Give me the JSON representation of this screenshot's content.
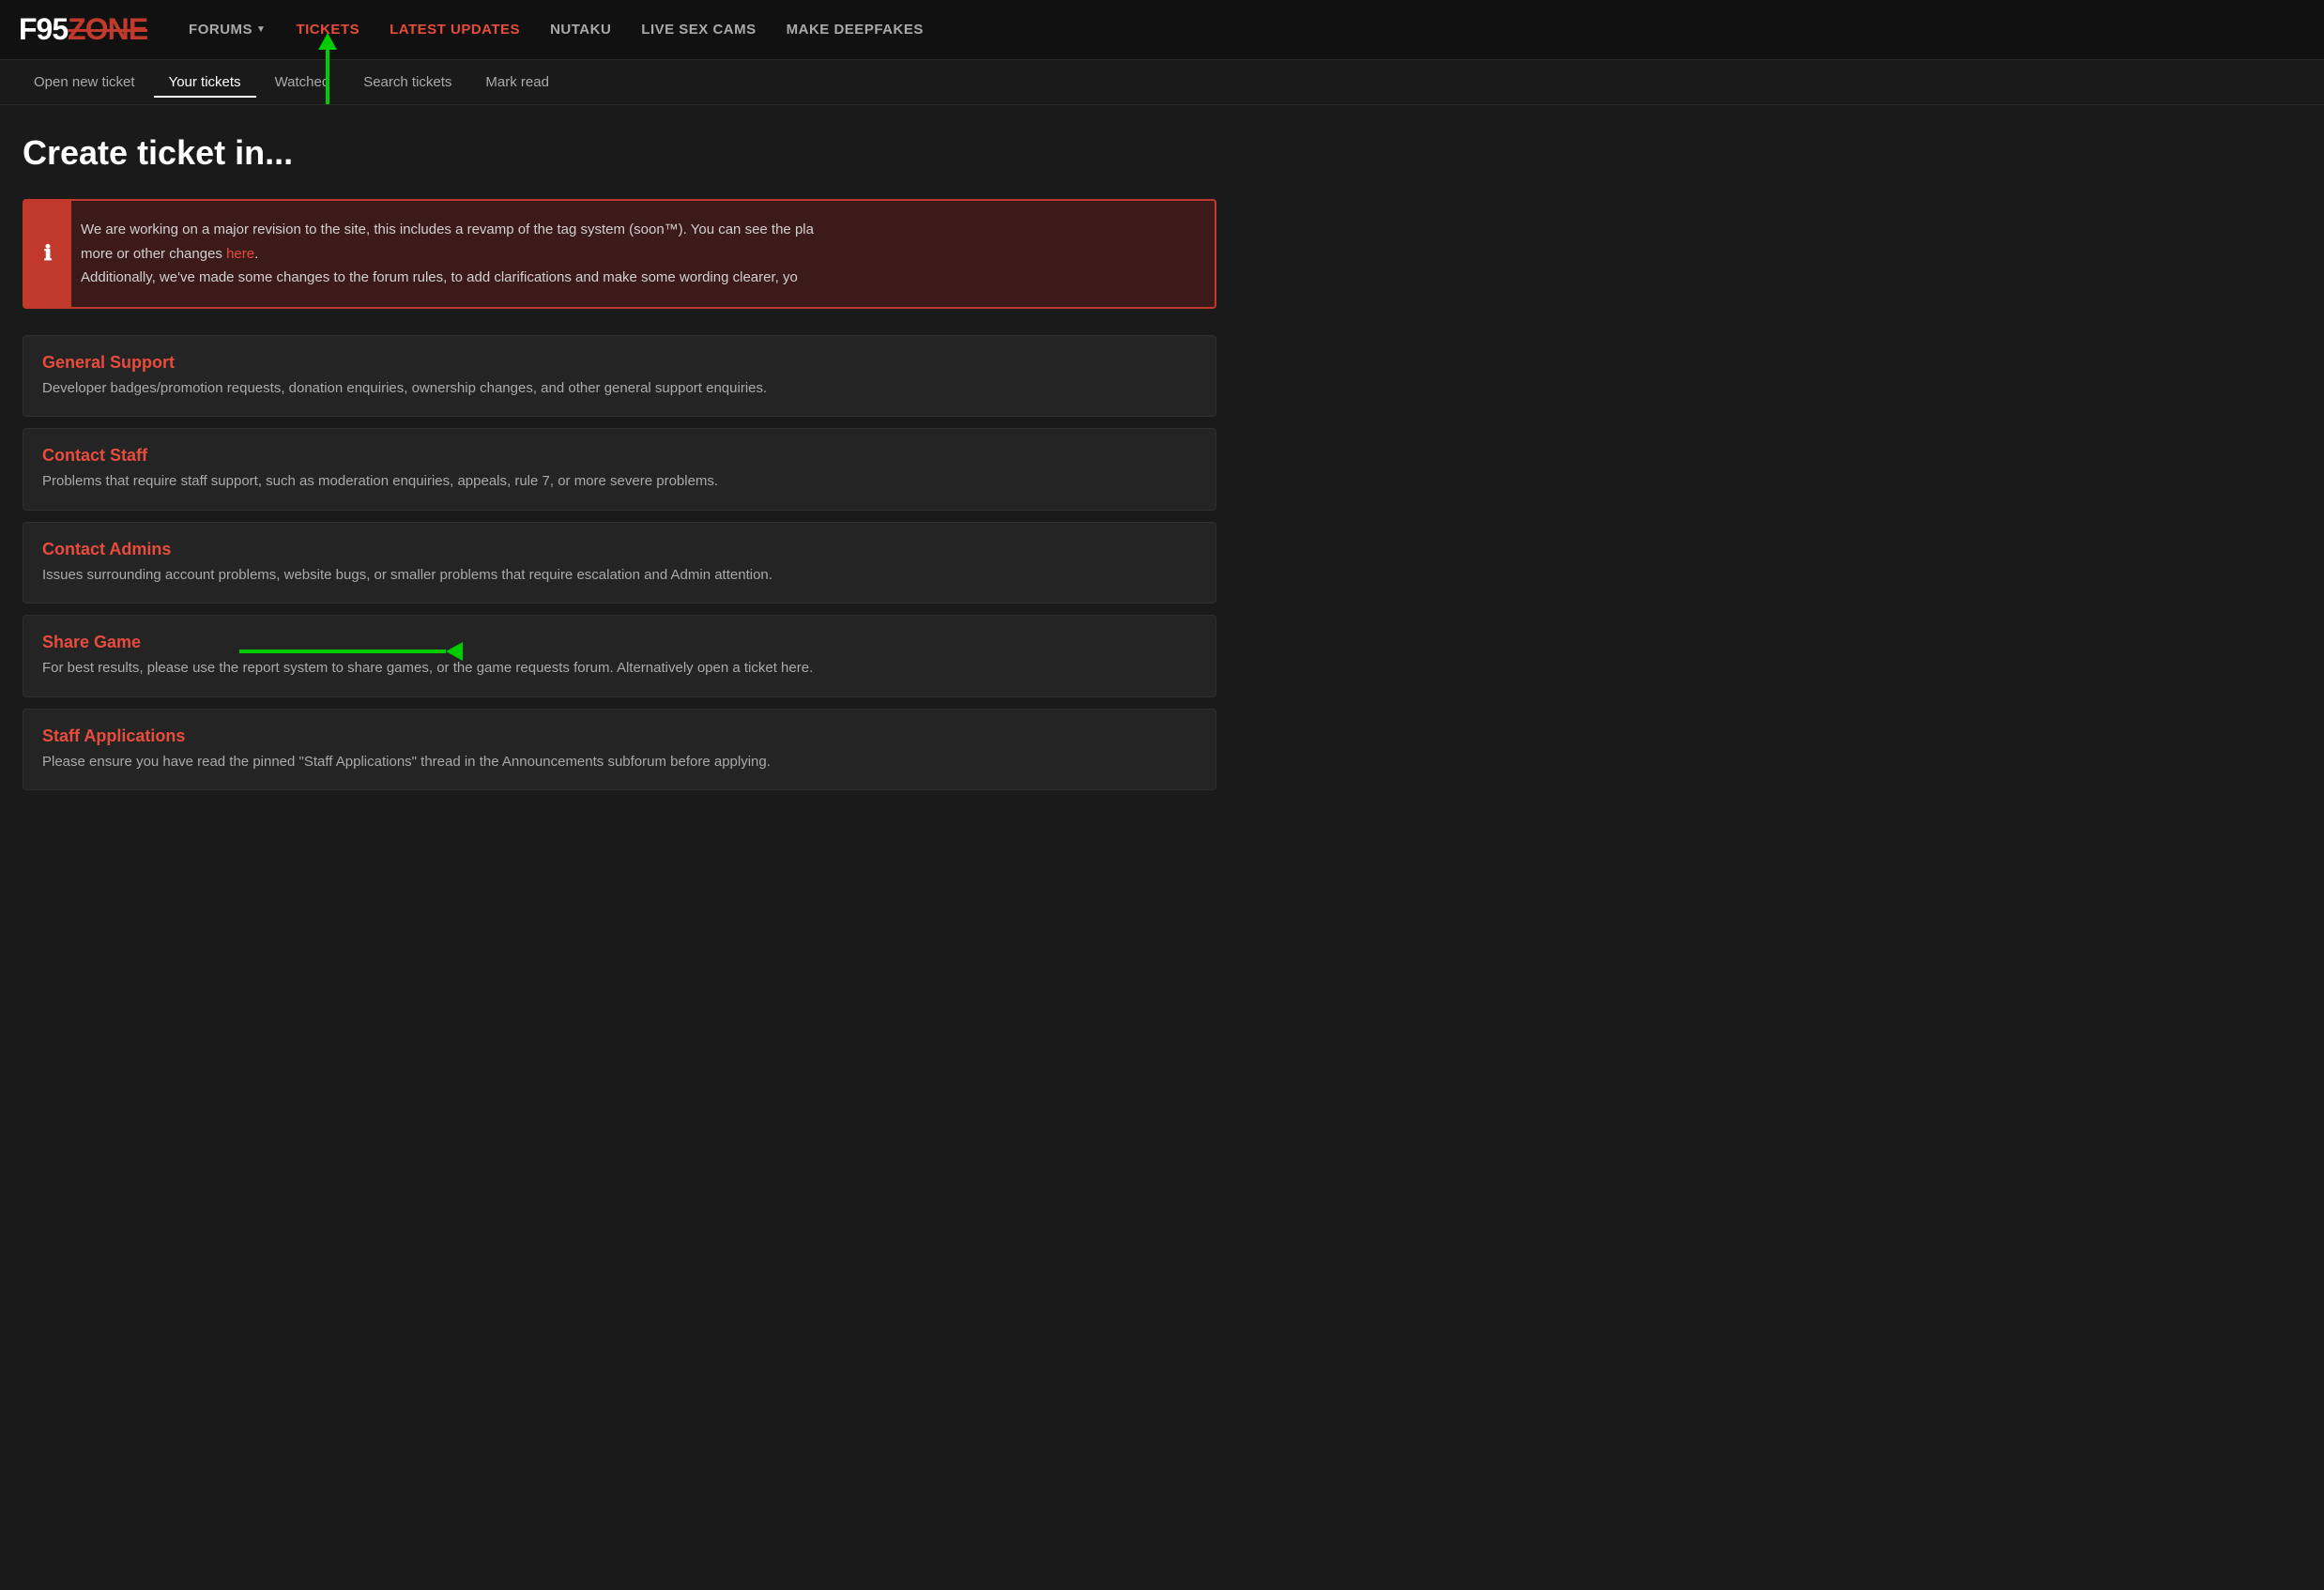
{
  "logo": {
    "f95": "F95",
    "zone": "ZONE"
  },
  "nav": {
    "items": [
      {
        "id": "forums",
        "label": "FORUMS",
        "hasDropdown": true,
        "active": false
      },
      {
        "id": "tickets",
        "label": "TICKETS",
        "active": true
      },
      {
        "id": "latest-updates",
        "label": "LATEST UPDATES",
        "active": false,
        "highlight": true
      },
      {
        "id": "nutaku",
        "label": "NUTAKU",
        "active": false
      },
      {
        "id": "live-sex-cams",
        "label": "LIVE SEX CAMS",
        "active": false
      },
      {
        "id": "make-deepfakes",
        "label": "MAKE DEEPFAKES",
        "active": false
      }
    ]
  },
  "subnav": {
    "items": [
      {
        "id": "open-new-ticket",
        "label": "Open new ticket",
        "active": false
      },
      {
        "id": "your-tickets",
        "label": "Your tickets",
        "active": true
      },
      {
        "id": "watched",
        "label": "Watched",
        "active": false
      },
      {
        "id": "search-tickets",
        "label": "Search tickets",
        "active": false
      },
      {
        "id": "mark-read",
        "label": "Mark read",
        "active": false
      }
    ]
  },
  "page": {
    "title": "Create ticket in..."
  },
  "notice": {
    "text_part1": "We are working on a major revision to the site, this includes a revamp of the tag system (soon™). You can see the pla",
    "text_part2": "more or other changes ",
    "link_text": "here",
    "text_part3": ".",
    "text_part4": "Additionally, we've made some changes to the forum rules, to add clarifications and make some wording clearer, yo"
  },
  "categories": [
    {
      "id": "general-support",
      "title": "General Support",
      "description": "Developer badges/promotion requests, donation enquiries, ownership changes, and other general support enquiries."
    },
    {
      "id": "contact-staff",
      "title": "Contact Staff",
      "description": "Problems that require staff support, such as moderation enquiries, appeals, rule 7, or more severe problems."
    },
    {
      "id": "contact-admins",
      "title": "Contact Admins",
      "description": "Issues surrounding account problems, website bugs, or smaller problems that require escalation and Admin attention."
    },
    {
      "id": "share-game",
      "title": "Share Game",
      "description": "For best results, please use the report system to share games, or the game requests forum. Alternatively open a ticket here."
    },
    {
      "id": "staff-applications",
      "title": "Staff Applications",
      "description": "Please ensure you have read the pinned \"Staff Applications\" thread in the Announcements subforum before applying."
    }
  ],
  "colors": {
    "accent_red": "#e74c3c",
    "accent_green": "#00cc00",
    "bg_dark": "#1a1a1a",
    "bg_header": "#111111",
    "bg_card": "#242424"
  }
}
